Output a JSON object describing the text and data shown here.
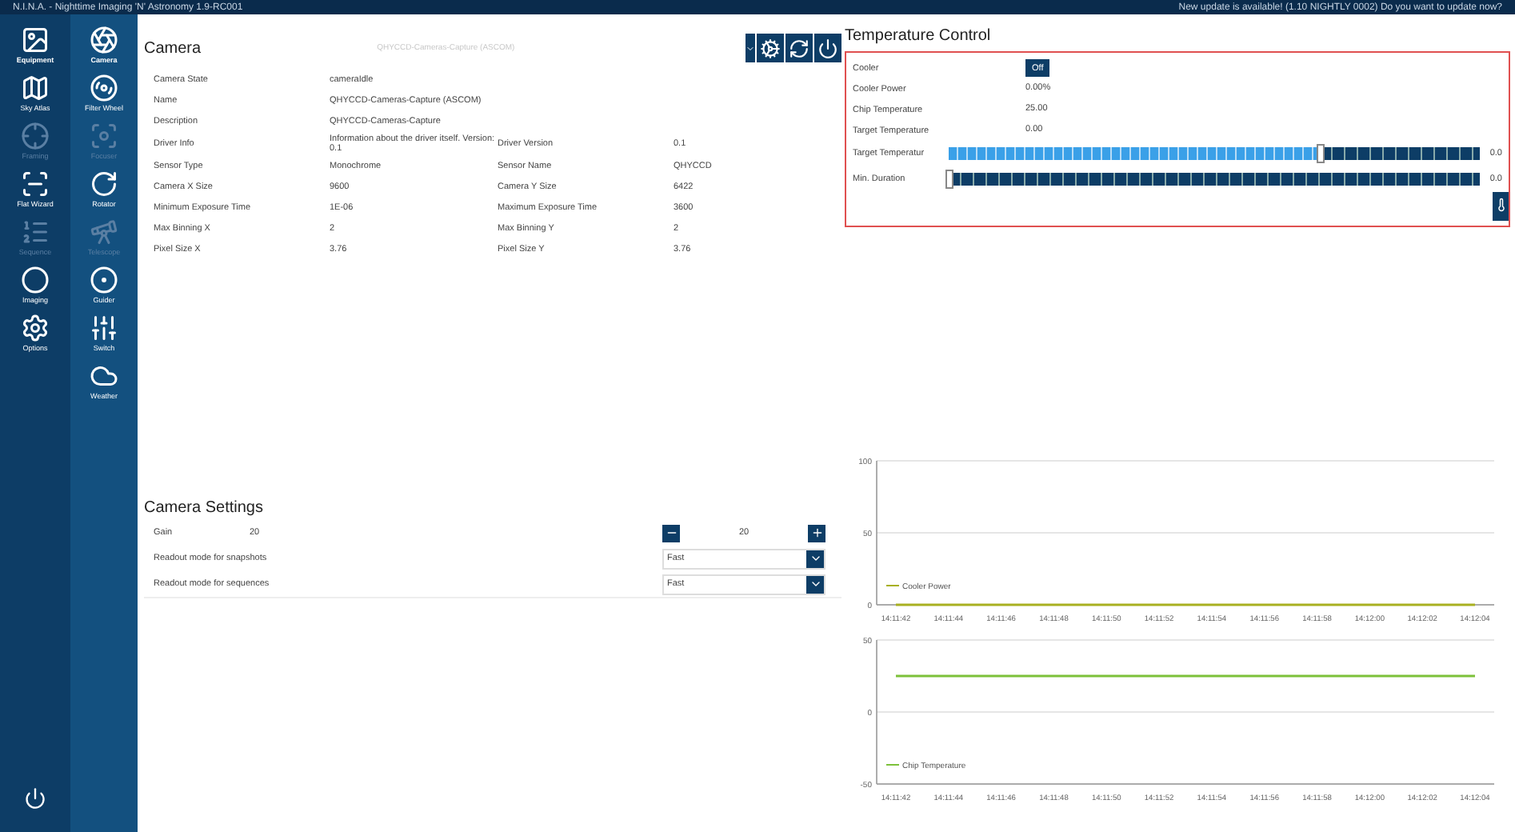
{
  "title_bar": {
    "title": "N.I.N.A. - Nighttime Imaging 'N' Astronomy 1.9-RC001",
    "notice": "New update is available! (1.10 NIGHTLY 0002) Do you want to update now?"
  },
  "main_nav": [
    {
      "label": "Equipment",
      "kind": "equipment",
      "selected": true,
      "disabled": false
    },
    {
      "label": "Sky Atlas",
      "kind": "atlas",
      "selected": false,
      "disabled": false
    },
    {
      "label": "Framing",
      "kind": "framing",
      "selected": false,
      "disabled": true
    },
    {
      "label": "Flat Wizard",
      "kind": "flat",
      "selected": false,
      "disabled": false
    },
    {
      "label": "Sequence",
      "kind": "sequence",
      "selected": false,
      "disabled": true
    },
    {
      "label": "Imaging",
      "kind": "imaging",
      "selected": false,
      "disabled": false
    },
    {
      "label": "Options",
      "kind": "options",
      "selected": false,
      "disabled": false
    }
  ],
  "device_nav": [
    {
      "label": "Camera",
      "kind": "camera",
      "selected": true,
      "disabled": false
    },
    {
      "label": "Filter Wheel",
      "kind": "filter",
      "selected": false,
      "disabled": false
    },
    {
      "label": "Focuser",
      "kind": "focuser",
      "selected": false,
      "disabled": true
    },
    {
      "label": "Rotator",
      "kind": "rotator",
      "selected": false,
      "disabled": false
    },
    {
      "label": "Telescope",
      "kind": "telescope",
      "selected": false,
      "disabled": true
    },
    {
      "label": "Guider",
      "kind": "guider",
      "selected": false,
      "disabled": false
    },
    {
      "label": "Switch",
      "kind": "switch",
      "selected": false,
      "disabled": false
    },
    {
      "label": "Weather",
      "kind": "weather",
      "selected": false,
      "disabled": false
    }
  ],
  "camera": {
    "title": "Camera",
    "device": "QHYCCD-Cameras-Capture (ASCOM)",
    "rows": [
      {
        "label": "Camera State",
        "value": "cameraIdle"
      },
      {
        "label": "Name",
        "value": "QHYCCD-Cameras-Capture (ASCOM)"
      },
      {
        "label": "Description",
        "value": "QHYCCD-Cameras-Capture"
      },
      {
        "label": "Driver Info",
        "value": "Information about the driver itself. Version: 0.1",
        "label_2": "Driver Version",
        "value_2": "0.1"
      },
      {
        "label": "Sensor Type",
        "value": "Monochrome",
        "label_2": "Sensor Name",
        "value_2": "QHYCCD"
      },
      {
        "label": "Camera X Size",
        "value": "9600",
        "label_2": "Camera Y Size",
        "value_2": "6422"
      },
      {
        "label": "Minimum Exposure Time",
        "value": "1E-06",
        "label_2": "Maximum Exposure Time",
        "value_2": "3600"
      },
      {
        "label": "Max Binning X",
        "value": "2",
        "label_2": "Max Binning Y",
        "value_2": "2"
      },
      {
        "label": "Pixel Size X",
        "value": "3.76",
        "label_2": "Pixel Size Y",
        "value_2": "3.76"
      }
    ]
  },
  "camera_settings": {
    "title": "Camera Settings",
    "gain": {
      "label": "Gain",
      "value": "20",
      "stepper_value": "20"
    },
    "readouts": [
      {
        "label": "Readout mode for snapshots",
        "value": "Fast"
      },
      {
        "label": "Readout mode for sequences",
        "value": "Fast"
      }
    ]
  },
  "temperature": {
    "title": "Temperature Control",
    "cooler": {
      "label": "Cooler",
      "button": "Off"
    },
    "readings": [
      {
        "label": "Cooler Power",
        "value": "0.00%"
      },
      {
        "label": "Chip Temperature",
        "value": "25.00"
      },
      {
        "label": "Target Temperature",
        "value": "0.00"
      }
    ],
    "sliders": [
      {
        "label": "Target Temperatur",
        "level": 0.7,
        "reading": "0.0"
      },
      {
        "label": "Min. Duration",
        "level": 0,
        "reading": "0.0"
      }
    ]
  },
  "charts": [
    {
      "chart_data": {
        "type": "line",
        "categories": [
          "14:11:42",
          "14:11:44",
          "14:11:46",
          "14:11:48",
          "14:11:50",
          "14:11:52",
          "14:11:54",
          "14:11:56",
          "14:11:58",
          "14:12:00",
          "14:12:02",
          "14:12:04"
        ],
        "series": [
          {
            "name": "Cooler Power",
            "color": "#a8b020",
            "values": [
              0,
              0,
              0,
              0,
              0,
              0,
              0,
              0,
              0,
              0,
              0,
              0
            ]
          }
        ],
        "ylim": [
          0,
          100
        ],
        "yticks": [
          0,
          50,
          100
        ]
      }
    },
    {
      "chart_data": {
        "type": "line",
        "categories": [
          "14:11:42",
          "14:11:44",
          "14:11:46",
          "14:11:48",
          "14:11:50",
          "14:11:52",
          "14:11:54",
          "14:11:56",
          "14:11:58",
          "14:12:00",
          "14:12:02",
          "14:12:04"
        ],
        "series": [
          {
            "name": "Chip Temperature",
            "color": "#7cc13a",
            "values": [
              25,
              25,
              25,
              25,
              25,
              25,
              25,
              25,
              25,
              25,
              25,
              25
            ]
          }
        ],
        "ylim": [
          -50,
          50
        ],
        "yticks": [
          -50,
          0,
          50
        ]
      }
    }
  ]
}
